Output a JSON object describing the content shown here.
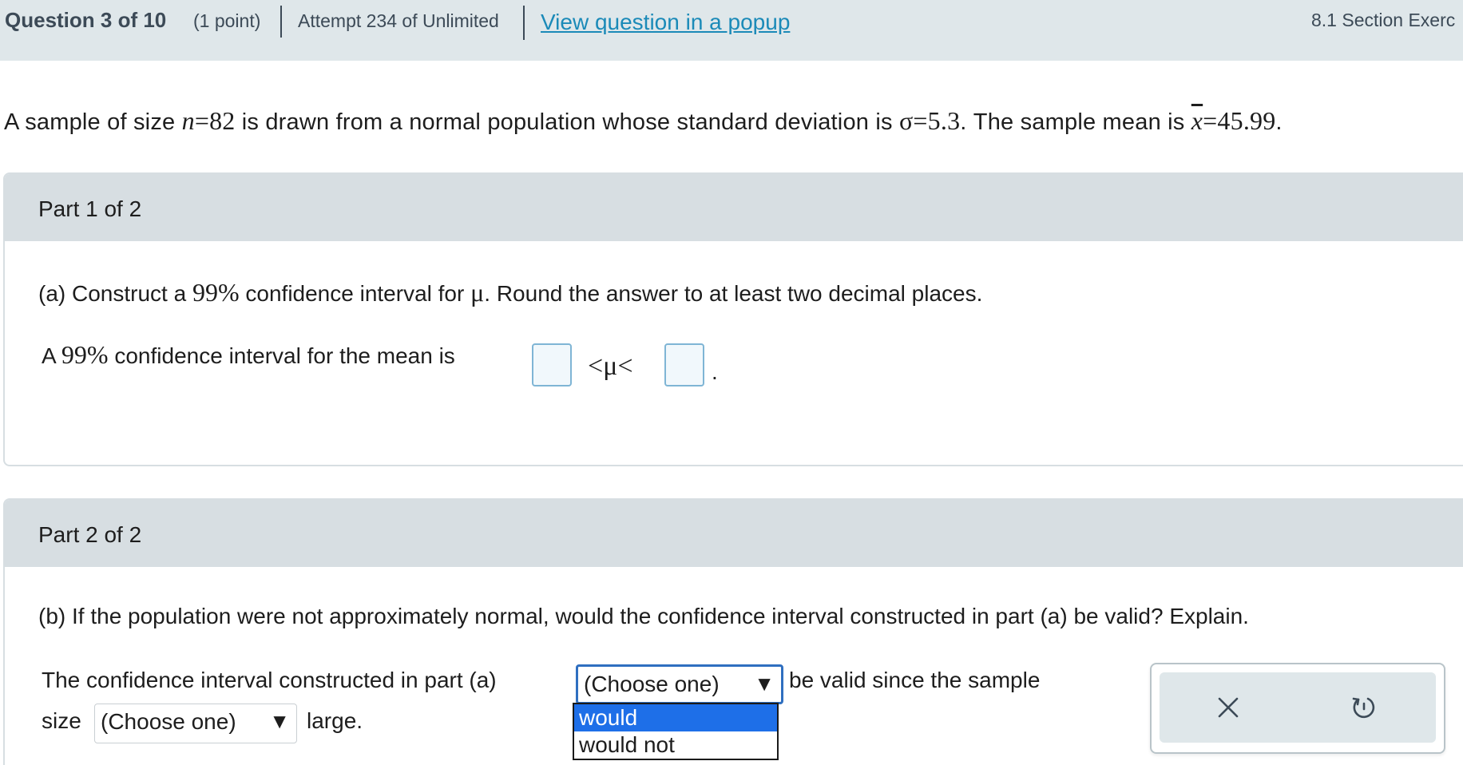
{
  "header": {
    "question_label": "Question 3 of 10",
    "points": "(1 point)",
    "attempt": "Attempt 234 of Unlimited",
    "popup_link": "View question in a popup",
    "section": "8.1 Section Exerc"
  },
  "problem": {
    "lead": "A sample of size ",
    "n_var": "n",
    "n_val": "=82",
    "mid": " is drawn from a normal population whose standard deviation is ",
    "sigma": "σ=5.3",
    "mid2": ". The sample mean is ",
    "xbar_var": "x",
    "xbar_val": "=45.99",
    "end": "."
  },
  "part1": {
    "label": "Part 1 of 2",
    "q_prefix": "(a) Construct a ",
    "q_pct": "99%",
    "q_mid": " confidence interval for ",
    "q_mu": "μ",
    "q_suffix": ". Round the answer to at least two decimal places.",
    "ci_prefix": "A ",
    "ci_pct": "99%",
    "ci_text": " confidence interval for the mean is",
    "ineq": "<μ<",
    "period": ".",
    "lower_value": "",
    "upper_value": ""
  },
  "part2": {
    "label": "Part 2 of 2",
    "question": "(b) If the population were not approximately normal, would the confidence interval constructed in part (a) be valid? Explain.",
    "sentence_start": "The confidence interval constructed in part (a)",
    "sentence_mid": "be valid since the sample",
    "sentence_size": "size",
    "sentence_end": "large.",
    "select1_value": "(Choose one)",
    "select2_value": "(Choose one)",
    "select_arrow": "▼",
    "dropdown_options": [
      "would",
      "would not"
    ],
    "dropdown_selected_index": 0
  },
  "tools": {
    "close_glyph": "✕",
    "reset_glyph": "↺"
  }
}
